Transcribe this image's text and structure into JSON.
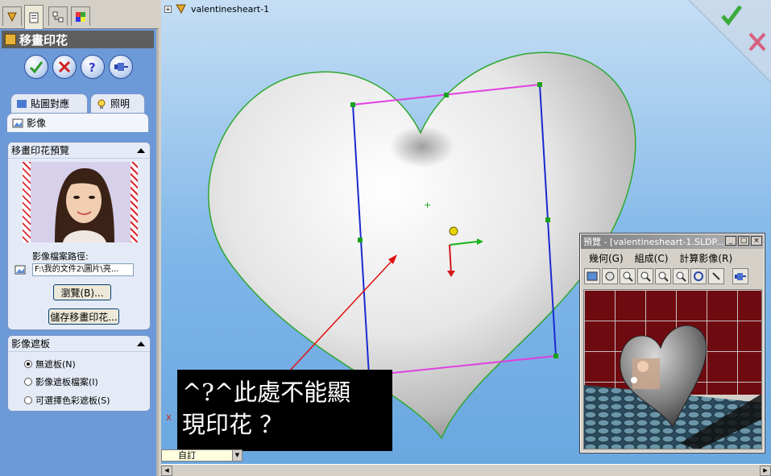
{
  "property_manager": {
    "title": "移畫印花",
    "tabs": {
      "mapping": "貼圖對應",
      "lighting": "照明",
      "image": "影像"
    },
    "preview_group": {
      "header": "移畫印花預覽",
      "path_label": "影像檔案路徑:",
      "path_value": "F:\\我的文件2\\圖片\\亮...",
      "browse_button": "瀏覽(B)...",
      "save_button": "儲存移畫印花..."
    },
    "mask_group": {
      "header": "影像遮板",
      "options": [
        "無遮板(N)",
        "影像遮板檔案(I)",
        "可選擇色彩遮板(S)"
      ],
      "selected": 0
    }
  },
  "graphics": {
    "tree_label": "valentinesheart-1",
    "annotation_line1": "^?^此處不能顯",
    "annotation_line2": "現印花 ？",
    "config_select": "自訂"
  },
  "preview_window": {
    "title": "預覽 - [valentinesheart-1.SLDP...",
    "menu": [
      "幾何(G)",
      "組成(C)",
      "計算影像(R)"
    ]
  },
  "colors": {
    "pm_background": "#6c99d8",
    "confirm_green": "#2e9a2e",
    "cancel_red": "#d02020",
    "decal_frame_magenta": "#e040e0",
    "decal_frame_blue": "#1a2ad0",
    "annotation_arrow": "#e01010"
  }
}
